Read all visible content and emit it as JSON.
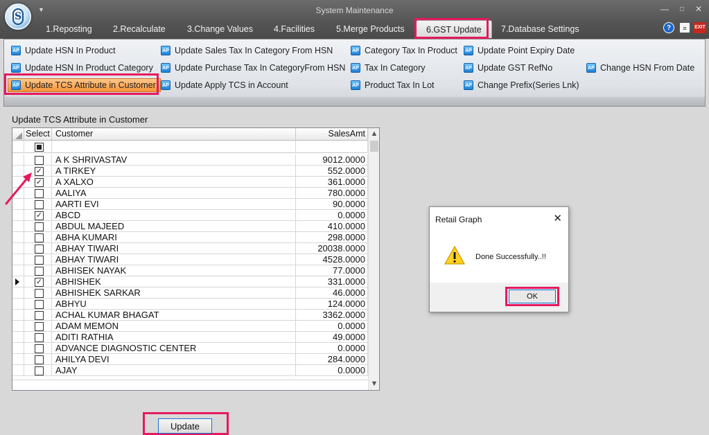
{
  "window": {
    "title": "System Maintenance",
    "minimize_glyph": "—",
    "maximize_glyph": "□",
    "close_glyph": "✕",
    "quick_access_glyph": "▼"
  },
  "tabs": [
    {
      "label": "1.Reposting"
    },
    {
      "label": "2.Recalculate"
    },
    {
      "label": "3.Change Values"
    },
    {
      "label": "4.Facilities"
    },
    {
      "label": "5.Merge Products"
    },
    {
      "label": "6.GST Update",
      "active": true
    },
    {
      "label": "7.Database Settings"
    }
  ],
  "header_icons": {
    "help": "?",
    "doc": "≡",
    "exit": "EXIT"
  },
  "ribbon": {
    "items": [
      {
        "label": "Update HSN In Product",
        "icon": "hsn-product-icon",
        "glyph": "AP"
      },
      {
        "label": "Update HSN In Product Category",
        "icon": "hsn-category-icon",
        "glyph": "AP"
      },
      {
        "label": "Update TCS Attribute in Customer",
        "icon": "tcs-customer-icon",
        "glyph": "AP",
        "selected": true
      },
      {
        "label": "Update Sales Tax In Category From HSN",
        "icon": "sales-tax-icon",
        "glyph": "AP"
      },
      {
        "label": "Update Purchase Tax In CategoryFrom HSN",
        "icon": "purchase-tax-icon",
        "glyph": "AP"
      },
      {
        "label": "Update Apply TCS in Account",
        "icon": "apply-tcs-icon",
        "glyph": "AP"
      },
      {
        "label": "Category Tax In Product",
        "icon": "category-tax-icon",
        "glyph": "AP"
      },
      {
        "label": "Tax In Category",
        "icon": "tax-category-icon",
        "glyph": "AP"
      },
      {
        "label": "Product Tax In Lot",
        "icon": "product-tax-lot-icon",
        "glyph": "AP"
      },
      {
        "label": "Update Point Expiry Date",
        "icon": "point-expiry-icon",
        "glyph": "AP"
      },
      {
        "label": "Update GST RefNo",
        "icon": "gst-refno-icon",
        "glyph": "AP"
      },
      {
        "label": "Change Prefix(Series Lnk)",
        "icon": "change-prefix-icon",
        "glyph": "AP"
      },
      {
        "label": "Change HSN From Date",
        "icon": "hsn-date-icon",
        "glyph": "AP"
      }
    ]
  },
  "panel": {
    "title": "Update TCS Attribute in Customer",
    "columns": {
      "select": "Select",
      "customer": "Customer",
      "sales_amt": "SalesAmt"
    },
    "rows": [
      {
        "customer": "A K SHRIVASTAV",
        "amount": "9012.0000",
        "checked": false
      },
      {
        "customer": "A TIRKEY",
        "amount": "552.0000",
        "checked": true
      },
      {
        "customer": "A XALXO",
        "amount": "361.0000",
        "checked": true
      },
      {
        "customer": "AALIYA",
        "amount": "780.0000",
        "checked": false
      },
      {
        "customer": "AARTI EVI",
        "amount": "90.0000",
        "checked": false
      },
      {
        "customer": "ABCD",
        "amount": "0.0000",
        "checked": true
      },
      {
        "customer": "ABDUL MAJEED",
        "amount": "410.0000",
        "checked": false
      },
      {
        "customer": "ABHA  KUMARI",
        "amount": "298.0000",
        "checked": false
      },
      {
        "customer": "ABHAY TIWARI",
        "amount": "20038.0000",
        "checked": false
      },
      {
        "customer": "ABHAY TIWARI",
        "amount": "4528.0000",
        "checked": false
      },
      {
        "customer": "ABHISEK NAYAK",
        "amount": "77.0000",
        "checked": false
      },
      {
        "customer": "ABHISHEK",
        "amount": "331.0000",
        "checked": true,
        "current": true
      },
      {
        "customer": "ABHISHEK SARKAR",
        "amount": "46.0000",
        "checked": false
      },
      {
        "customer": "ABHYU",
        "amount": "124.0000",
        "checked": false
      },
      {
        "customer": "ACHAL KUMAR BHAGAT",
        "amount": "3362.0000",
        "checked": false
      },
      {
        "customer": "ADAM MEMON",
        "amount": "0.0000",
        "checked": false
      },
      {
        "customer": "ADITI RATHIA",
        "amount": "49.0000",
        "checked": false
      },
      {
        "customer": "ADVANCE DIAGNOSTIC CENTER",
        "amount": "0.0000",
        "checked": false
      },
      {
        "customer": "AHILYA DEVI",
        "amount": "284.0000",
        "checked": false
      },
      {
        "customer": "AJAY",
        "amount": "0.0000",
        "checked": false
      }
    ],
    "update_label": "Update",
    "scroll_up": "▲",
    "scroll_down": "▼"
  },
  "dialog": {
    "title": "Retail Graph",
    "message": "Done Successfully..!!",
    "ok_label": "OK",
    "close_glyph": "✕"
  },
  "colors": {
    "highlight": "#e5195e",
    "ribbon_selected": "#f7943a",
    "titlebar": "#545454"
  }
}
